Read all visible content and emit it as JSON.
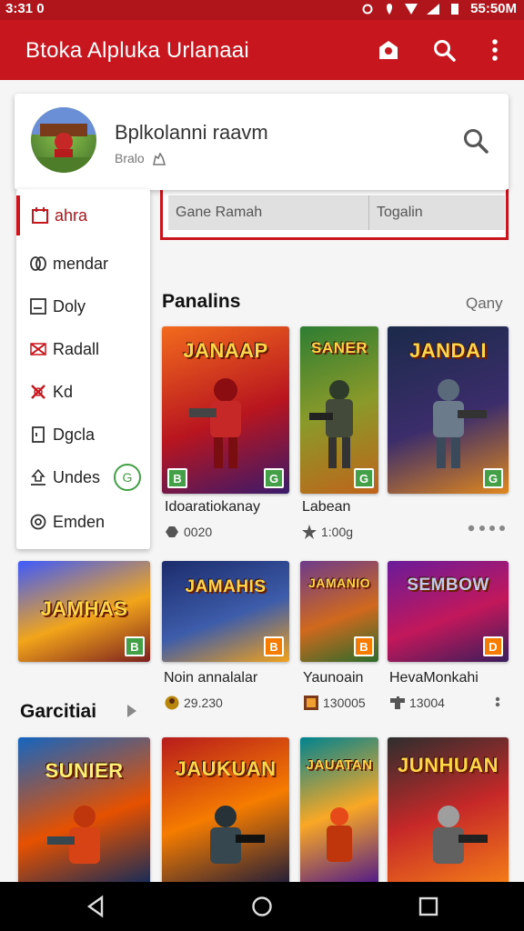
{
  "status": {
    "time": "3:31 0",
    "clock_right": "55:50M"
  },
  "appbar": {
    "title": "Btoka Alpluka Urlanaai"
  },
  "search_card": {
    "name": "Bplkolanni raavm",
    "sub": "Bralo"
  },
  "tabs": [
    "Gane Ramah",
    "Togalin"
  ],
  "menu": [
    {
      "label": "ahra",
      "icon": "calendar-icon",
      "active": true
    },
    {
      "label": "mendar",
      "icon": "link-icon"
    },
    {
      "label": "Doly",
      "icon": "checkbox-icon"
    },
    {
      "label": "Radall",
      "icon": "shuffle-icon"
    },
    {
      "label": "Kd",
      "icon": "cross-icon"
    },
    {
      "label": "Dgcla",
      "icon": "document-icon"
    },
    {
      "label": "Undes",
      "icon": "upload-icon",
      "badge": "G"
    },
    {
      "label": "Emden",
      "icon": "settings-circle-icon"
    }
  ],
  "section1": {
    "title": "Panalins",
    "more": "Qany"
  },
  "section2": {
    "title": "Garcitiai"
  },
  "games_row1": [
    {
      "logo": "JANAAP",
      "name": "Idoaratiokanay",
      "meta": "0020",
      "meta_icon": "gamepad-icon",
      "colors": [
        "#f26b1d",
        "#b8151f",
        "#3a1a6b"
      ]
    },
    {
      "logo": "SANER",
      "name": "Labean",
      "meta": "1:00g",
      "meta_icon": "star-icon",
      "colors": [
        "#2e7d32",
        "#8a9a2a",
        "#c0631a"
      ]
    },
    {
      "logo": "JANDAI",
      "name": "",
      "meta": "",
      "meta_icon": "",
      "colors": [
        "#1b2a4a",
        "#3b2d6b",
        "#e0871d"
      ]
    }
  ],
  "games_row2": [
    {
      "logo": "JAMHAS",
      "name": "",
      "meta": "",
      "colors": [
        "#3d5afe",
        "#f2a51a",
        "#7b1f1f"
      ]
    },
    {
      "logo": "JAMAHIS",
      "name": "Noin annalalar",
      "meta": "29.230",
      "meta_icon": "avatar-icon",
      "colors": [
        "#1c2c6c",
        "#3d5caa",
        "#f3a21a"
      ]
    },
    {
      "logo": "JAMANIO",
      "name": "Yaunoain",
      "meta": "130005",
      "meta_icon": "thumbnail-icon",
      "colors": [
        "#6d3b8a",
        "#d0691e",
        "#2b6b2b"
      ]
    },
    {
      "logo": "SEMBOW",
      "name": "HevaMonkahi",
      "meta": "13004",
      "meta_icon": "puzzle-icon",
      "colors": [
        "#6a1b9a",
        "#c2185b",
        "#3a1d5a"
      ]
    }
  ],
  "games_row3": [
    {
      "logo": "SUNIER",
      "colors": [
        "#1565c0",
        "#e65100",
        "#0d2a5c"
      ]
    },
    {
      "logo": "JAUKUAN",
      "colors": [
        "#b71c1c",
        "#f57c00",
        "#1a1a3a"
      ]
    },
    {
      "logo": "JAUATAN",
      "colors": [
        "#00838f",
        "#f9a825",
        "#4a148c"
      ]
    },
    {
      "logo": "JUNHUAN",
      "colors": [
        "#2e2e2e",
        "#c62828",
        "#f57f17"
      ]
    }
  ],
  "colors": {
    "accent": "#c8161e",
    "statusbar": "#b0151b",
    "badge_green": "#43a047"
  }
}
